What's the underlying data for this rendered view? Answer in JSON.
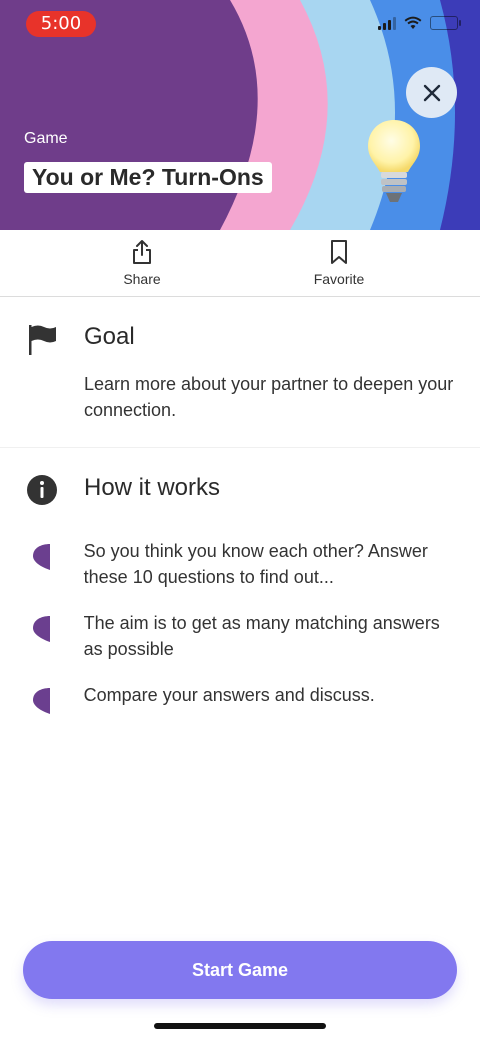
{
  "status": {
    "time": "5:00"
  },
  "hero": {
    "category": "Game",
    "title": "You or Me? Turn-Ons",
    "colors": {
      "purple": "#6f3d8a",
      "pink": "#f4a6d0",
      "sky": "#a8d6f1",
      "blue": "#4a8ee8",
      "navy": "#3c3cb8"
    }
  },
  "actions": {
    "share": "Share",
    "favorite": "Favorite"
  },
  "goal": {
    "heading": "Goal",
    "text": "Learn more about your partner to deepen your connection."
  },
  "how": {
    "heading": "How it works",
    "bullets": [
      "So you think you know each other? Answer these 10 questions to find out...",
      "The aim is to get as many matching answers as possible",
      "Compare your answers and discuss."
    ]
  },
  "cta": {
    "label": "Start Game",
    "color": "#8278ef"
  }
}
